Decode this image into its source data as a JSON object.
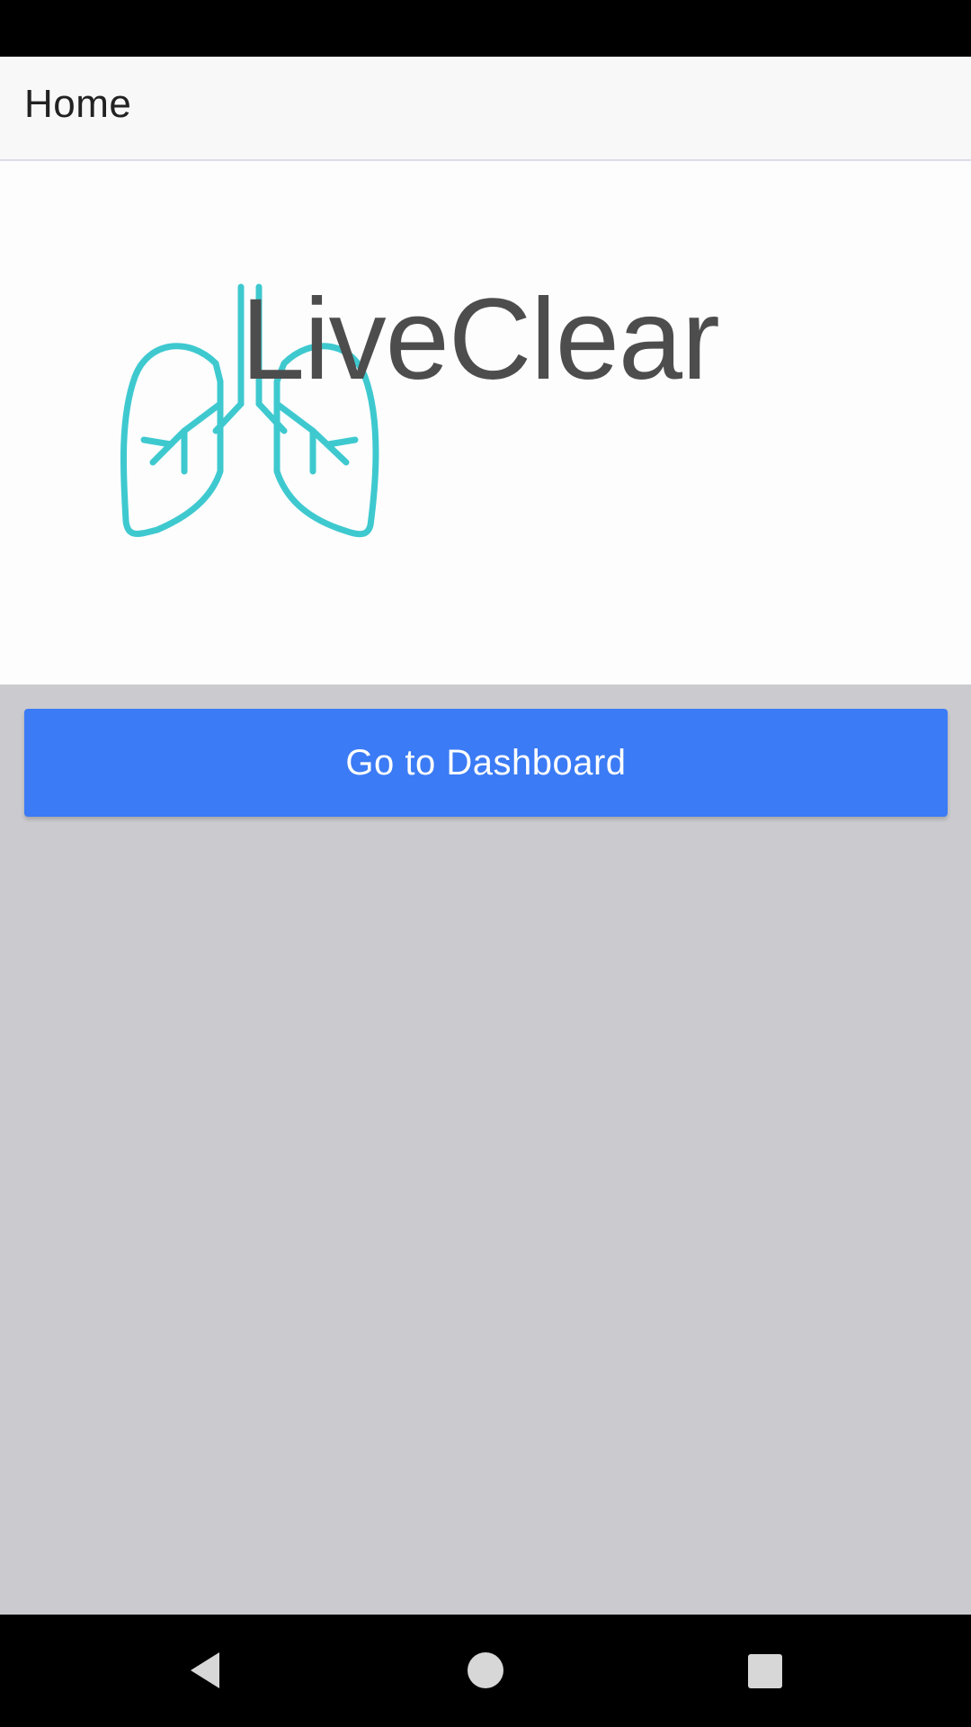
{
  "app_bar": {
    "title": "Home"
  },
  "logo": {
    "text": "LiveClear",
    "icon": "lungs-icon",
    "icon_color": "#3ec9cf",
    "text_color": "#4d4d4d"
  },
  "main": {
    "dashboard_button_label": "Go to Dashboard",
    "button_color": "#3b7bf5"
  },
  "nav_bar": {
    "back_icon": "back-triangle-icon",
    "home_icon": "home-circle-icon",
    "recents_icon": "recents-square-icon"
  }
}
